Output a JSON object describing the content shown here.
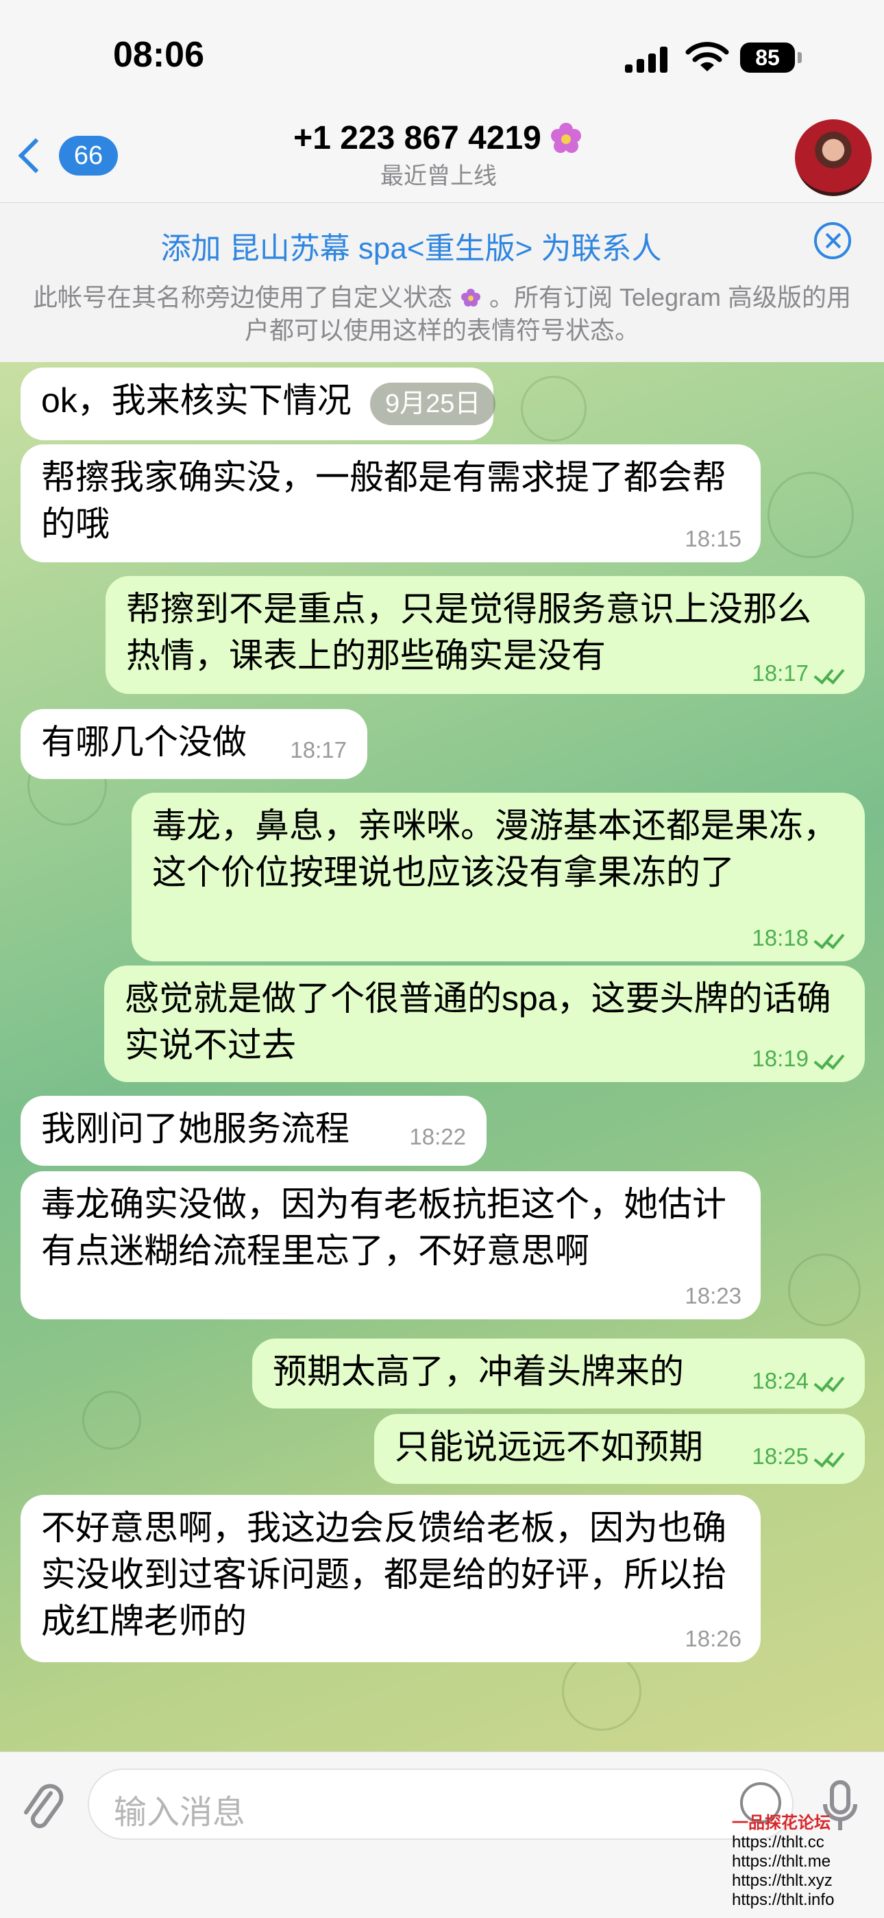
{
  "status": {
    "time": "08:06",
    "battery": "85"
  },
  "header": {
    "back_count": "66",
    "title": "+1 223 867 4219",
    "subtitle": "最近曾上线"
  },
  "banner": {
    "add_contact": "添加 昆山苏幕 spa<重生版> 为联系人",
    "notice_before": "此帐号在其名称旁边使用了自定义状态",
    "notice_after": "。所有订阅 Telegram 高级版的用户都可以使用这样的表情符号状态。"
  },
  "date_pill": "9月25日",
  "messages": [
    {
      "dir": "in",
      "text": "ok，我来核实下情况",
      "time": ""
    },
    {
      "dir": "in",
      "text": "帮擦我家确实没，一般都是有需求提了都会帮的哦",
      "time": "18:15"
    },
    {
      "dir": "out",
      "text": "帮擦到不是重点，只是觉得服务意识上没那么热情，课表上的那些确实是没有",
      "time": "18:17"
    },
    {
      "dir": "in",
      "text": "有哪几个没做",
      "time": "18:17"
    },
    {
      "dir": "out",
      "text": "毒龙，鼻息，亲咪咪。漫游基本还都是果冻，这个价位按理说也应该没有拿果冻的了",
      "time": "18:18"
    },
    {
      "dir": "out",
      "text": "感觉就是做了个很普通的spa，这要头牌的话确实说不过去",
      "time": "18:19"
    },
    {
      "dir": "in",
      "text": "我刚问了她服务流程",
      "time": "18:22"
    },
    {
      "dir": "in",
      "text": "毒龙确实没做，因为有老板抗拒这个，她估计有点迷糊给流程里忘了，不好意思啊",
      "time": "18:23"
    },
    {
      "dir": "out",
      "text": "预期太高了，冲着头牌来的",
      "time": "18:24"
    },
    {
      "dir": "out",
      "text": "只能说远远不如预期",
      "time": "18:25"
    },
    {
      "dir": "in",
      "text": "不好意思啊，我这边会反馈给老板，因为也确实没收到过客诉问题，都是给的好评，所以抬成红牌老师的",
      "time": "18:26"
    }
  ],
  "composer": {
    "placeholder": "输入消息"
  },
  "watermark": {
    "title": "一品探花论坛",
    "lines": [
      "https://thlt.cc",
      "https://thlt.me",
      "https://thlt.xyz",
      "https://thlt.info"
    ]
  },
  "colors": {
    "accent": "#2f86e0",
    "outgoing_bubble": "#e2fdc9",
    "incoming_bubble": "#ffffff",
    "read_check": "#4caf50"
  }
}
